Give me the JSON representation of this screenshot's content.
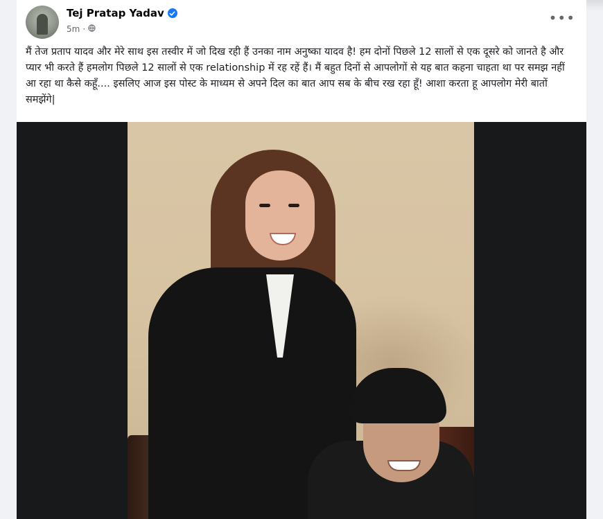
{
  "post": {
    "author_name": "Tej Pratap Yadav",
    "timestamp": "5m",
    "audience_icon": "globe-icon",
    "verified_icon": "verified-badge-icon",
    "more_icon": "more-options-icon",
    "text": "मैं तेज प्रताप यादव और  मेरे साथ इस तस्वीर में जो दिख रही हैं उनका नाम अनुष्का यादव है! हम दोनों पिछले 12 सालों से एक दूसरे को जानते है और प्यार भी करते हैं हमलोग पिछले 12 सालों से एक relationship में रह रहें हैं। मैं बहुत दिनों से आपलोगों से यह बात कहना चाहता था पर समझ नहीं आ रहा था कैसे कहूँ.... इसलिए आज इस पोस्ट के माध्यम से अपने दिल का बात आप सब के बीच रख रहा हूँ! आशा करता हू आपलोग मेरी बातों समझेंगे|"
  },
  "colors": {
    "page_bg": "#f0f2f5",
    "card_bg": "#ffffff",
    "verified": "#1877f2",
    "meta_text": "#65676b",
    "media_bg": "#18191a"
  }
}
